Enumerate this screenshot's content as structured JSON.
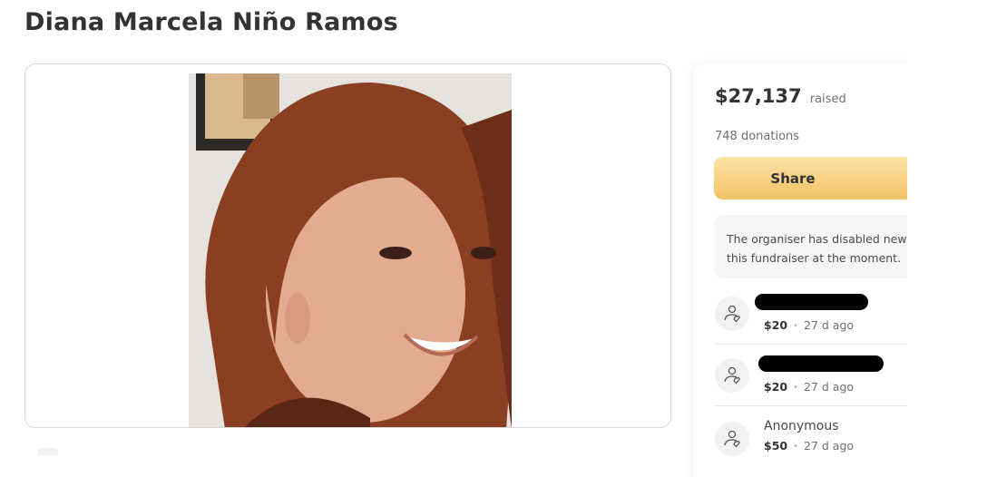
{
  "page": {
    "title": "Diana Marcela Niño Ramos"
  },
  "campaign": {
    "amount_raised": "$27,137",
    "raised_label": "raised",
    "donations_count": "748 donations",
    "share_label": "Share",
    "notice_line1": "The organiser has disabled new d",
    "notice_line2": "this fundraiser at the moment."
  },
  "donors": [
    {
      "name": "",
      "redacted": true,
      "amount": "$20",
      "time": "27 d ago"
    },
    {
      "name": "",
      "redacted": true,
      "amount": "$20",
      "time": "27 d ago"
    },
    {
      "name": "Anonymous",
      "redacted": false,
      "amount": "$50",
      "time": "27 d ago"
    }
  ],
  "icons": {
    "donor_avatar": "hand-heart-icon",
    "bullet": "•"
  },
  "colors": {
    "share_gradient_top": "#fbe2a6",
    "share_gradient_bottom": "#f4c265",
    "title_text": "#333333",
    "muted_text": "#6f6f6f"
  }
}
